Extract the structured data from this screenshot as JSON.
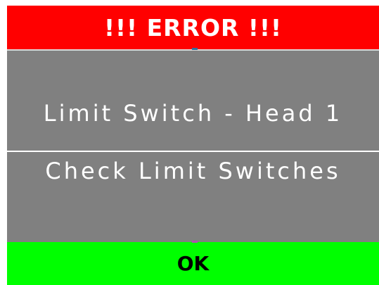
{
  "dialog": {
    "title": "!!! ERROR !!!",
    "message_line_1": "Limit Switch - Head 1",
    "message_line_2": "Check Limit Switches",
    "ok_label": "OK"
  },
  "colors": {
    "header": "#ff0000",
    "body": "#808080",
    "ok_button": "#00ff00",
    "text_light": "#ffffff",
    "text_dark": "#000000"
  }
}
